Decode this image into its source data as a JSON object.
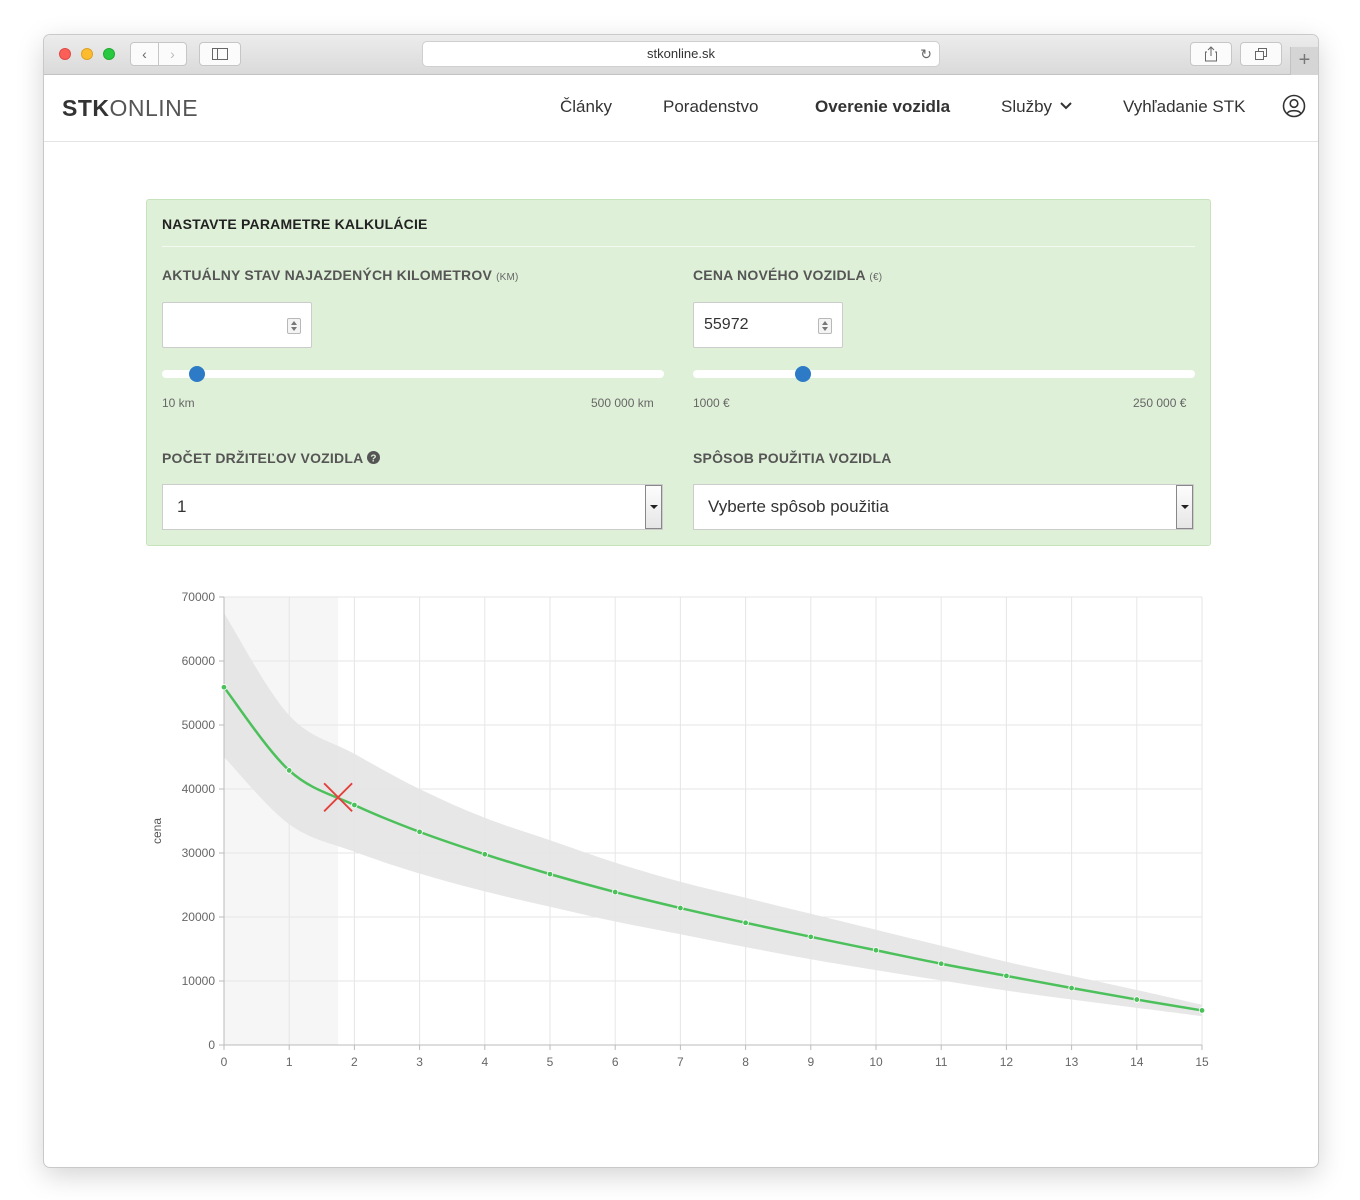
{
  "browser": {
    "url": "stkonline.sk"
  },
  "header": {
    "logo_bold": "STK",
    "logo_light": "ONLINE",
    "nav": [
      {
        "label": "Články"
      },
      {
        "label": "Poradenstvo"
      },
      {
        "label": "Overenie vozidla"
      },
      {
        "label": "Služby"
      },
      {
        "label": "Vyhľadanie STK"
      }
    ]
  },
  "calculator": {
    "title": "NASTAVTE PARAMETRE KALKULÁCIE",
    "km": {
      "label": "AKTUÁLNY STAV NAJAZDENÝCH KILOMETROV",
      "unit": "(KM)",
      "value": "",
      "slider_fraction": 0.07,
      "min_label": "10 km",
      "max_label": "500 000 km"
    },
    "price": {
      "label": "CENA NOVÉHO VOZIDLA",
      "unit": "(€)",
      "value": "55972",
      "slider_fraction": 0.22,
      "min_label": "1000 €",
      "max_label": "250 000 €"
    },
    "owners": {
      "label": "POČET DRŽITEĽOV VOZIDLA",
      "selected": "1"
    },
    "usage": {
      "label": "SPÔSOB POUŽITIA VOZIDLA",
      "selected": "Vyberte spôsob použitia"
    }
  },
  "colors": {
    "calc_bg": "#dff0d8",
    "line": "#4cc05a",
    "band": "#e4e4e4",
    "highlight": "#f6f6f6",
    "marker": "#e3413c",
    "slider_thumb": "#2d7ac6"
  },
  "chart_data": {
    "type": "line",
    "ylabel": "cena",
    "xlabel": "",
    "xlim": [
      0,
      15
    ],
    "ylim": [
      0,
      70000
    ],
    "x_ticks": [
      0,
      1,
      2,
      3,
      4,
      5,
      6,
      7,
      8,
      9,
      10,
      11,
      12,
      13,
      14,
      15
    ],
    "y_ticks": [
      0,
      10000,
      20000,
      30000,
      40000,
      50000,
      60000,
      70000
    ],
    "series": [
      {
        "x": [
          0,
          1,
          2,
          3,
          4,
          5,
          6,
          7,
          8,
          9,
          10,
          11,
          12,
          13,
          14,
          15
        ],
        "values": [
          55900,
          42900,
          37500,
          33300,
          29800,
          26700,
          23900,
          21400,
          19100,
          16900,
          14800,
          12700,
          10800,
          8900,
          7100,
          5400
        ]
      }
    ],
    "band_upper": [
      67500,
      51500,
      45500,
      40000,
      35500,
      32000,
      28500,
      25500,
      23000,
      20500,
      18000,
      15500,
      13000,
      10800,
      8600,
      6300
    ],
    "band_lower": [
      45000,
      34500,
      30200,
      26800,
      24000,
      21600,
      19300,
      17300,
      15300,
      13400,
      11700,
      10100,
      8500,
      7100,
      5800,
      4500
    ],
    "highlight_range": [
      0,
      1.75
    ],
    "marker": {
      "x": 1.75,
      "y": 38700
    }
  }
}
